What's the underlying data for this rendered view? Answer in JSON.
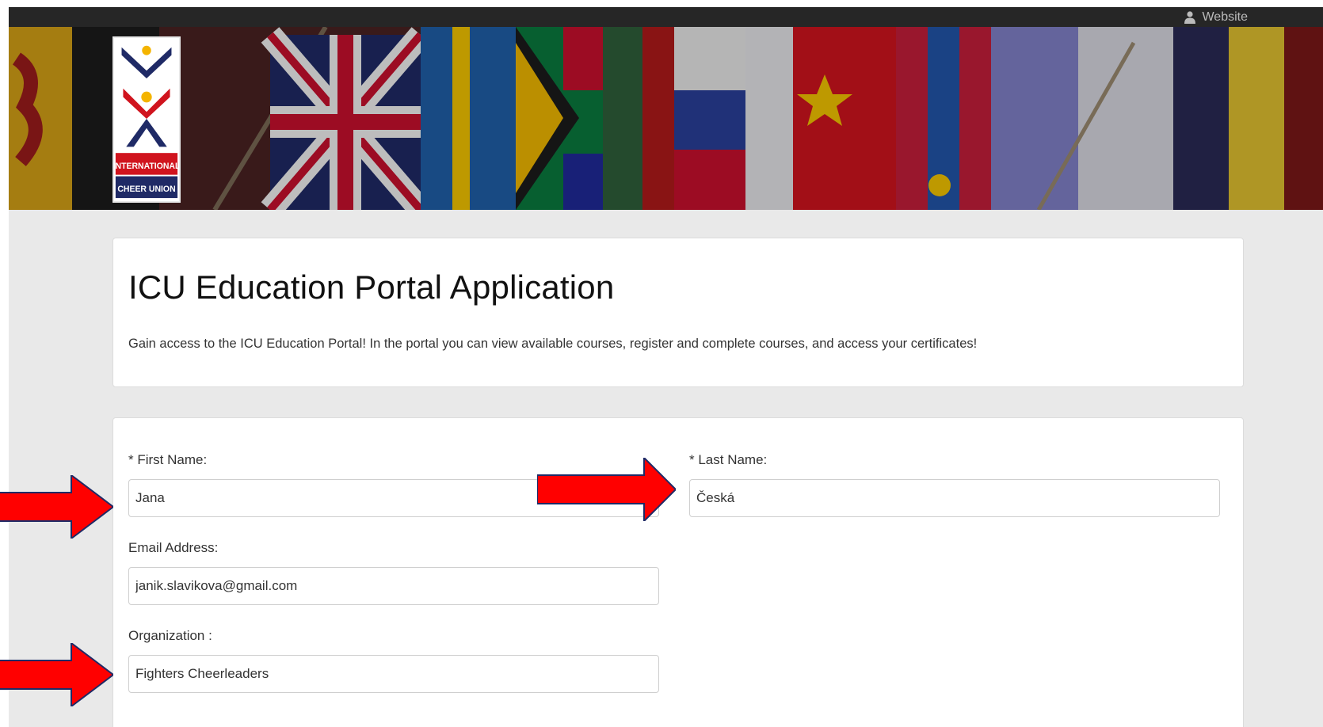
{
  "topbar": {
    "link_label": "Website",
    "link_icon": "user-icon"
  },
  "logo": {
    "line1": "INTERNATIONAL",
    "line2": "CHEER UNION"
  },
  "header": {
    "title": "ICU Education Portal Application",
    "description": "Gain access to the ICU Education Portal! In the portal you can view available courses, register and complete courses, and access your certificates!"
  },
  "form": {
    "first_name": {
      "label": "* First Name:",
      "value": "Jana"
    },
    "last_name": {
      "label": "* Last Name:",
      "value": "Česká"
    },
    "email": {
      "label": "Email Address:",
      "value": "janik.slavikova@gmail.com"
    },
    "organization": {
      "label": "Organization :",
      "value": "Fighters Cheerleaders"
    }
  },
  "annotation_color": "#ff0000"
}
